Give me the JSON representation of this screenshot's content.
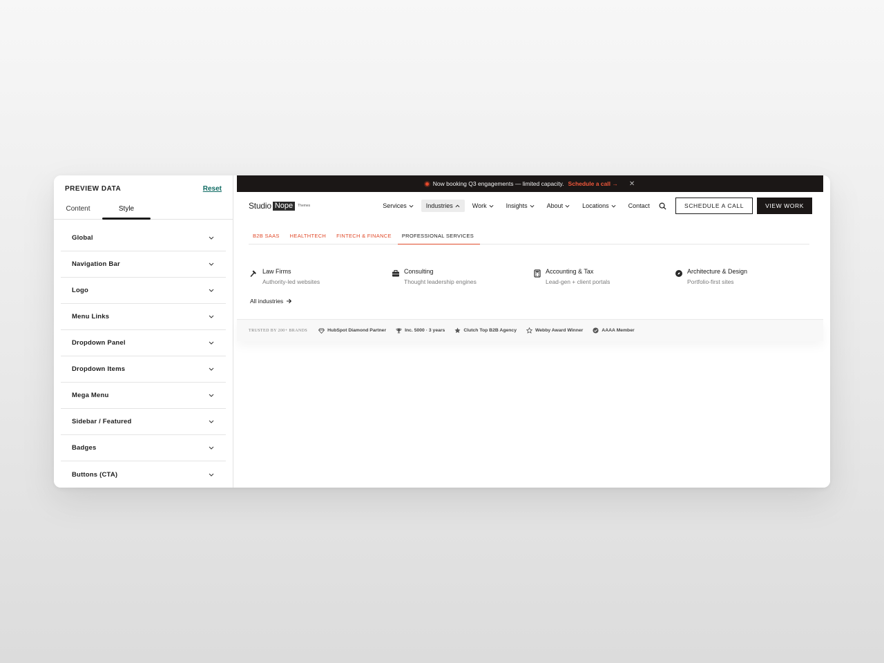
{
  "panel": {
    "title": "PREVIEW DATA",
    "reset": "Reset",
    "tabs": [
      "Content",
      "Style"
    ],
    "active_tab": "Style",
    "sections": [
      "Global",
      "Navigation Bar",
      "Logo",
      "Menu Links",
      "Dropdown Panel",
      "Dropdown Items",
      "Mega Menu",
      "Sidebar / Featured",
      "Badges",
      "Buttons (CTA)"
    ]
  },
  "announce": {
    "text": "Now booking Q3 engagements — limited capacity.",
    "link": "Schedule a call →",
    "close": "✕"
  },
  "logo": {
    "studio": "Studio",
    "nope": "Nope",
    "themes": "Themes"
  },
  "menu": [
    {
      "label": "Services",
      "caret": "⌄"
    },
    {
      "label": "Industries",
      "caret": "⌃"
    },
    {
      "label": "Work",
      "caret": "⌄"
    },
    {
      "label": "Insights",
      "caret": "⌄"
    },
    {
      "label": "About",
      "caret": "⌄"
    },
    {
      "label": "Locations",
      "caret": "⌄"
    },
    {
      "label": "Contact",
      "caret": ""
    }
  ],
  "cta": {
    "schedule": "SCHEDULE A CALL",
    "view": "VIEW WORK"
  },
  "industry_tabs": [
    "B2B SAAS",
    "HEALTHTECH",
    "FINTECH & FINANCE",
    "PROFESSIONAL SERVICES"
  ],
  "active_industry": "PROFESSIONAL SERVICES",
  "items": [
    {
      "title": "Law Firms",
      "desc": "Authority-led websites",
      "icon": "gavel-icon"
    },
    {
      "title": "Consulting",
      "desc": "Thought leadership engines",
      "icon": "briefcase-icon"
    },
    {
      "title": "Accounting & Tax",
      "desc": "Lead-gen + client portals",
      "icon": "calculator-icon"
    },
    {
      "title": "Architecture & Design",
      "desc": "Portfolio-first sites",
      "icon": "compass-icon"
    }
  ],
  "all_industries": "All industries",
  "trust": {
    "label": "TRUSTED BY 200+ BRANDS",
    "badges": [
      {
        "label": "HubSpot Diamond Partner",
        "icon": "diamond-icon"
      },
      {
        "label": "Inc. 5000 · 3 years",
        "icon": "trophy-icon"
      },
      {
        "label": "Clutch Top B2B Agency",
        "icon": "star-filled-icon"
      },
      {
        "label": "Webby Award Winner",
        "icon": "star-outline-icon"
      },
      {
        "label": "AAAA Member",
        "icon": "check-circle-icon"
      }
    ]
  },
  "colors": {
    "accent": "#e04a2a",
    "dark": "#1b1716",
    "reset_link": "#0f6b63"
  }
}
